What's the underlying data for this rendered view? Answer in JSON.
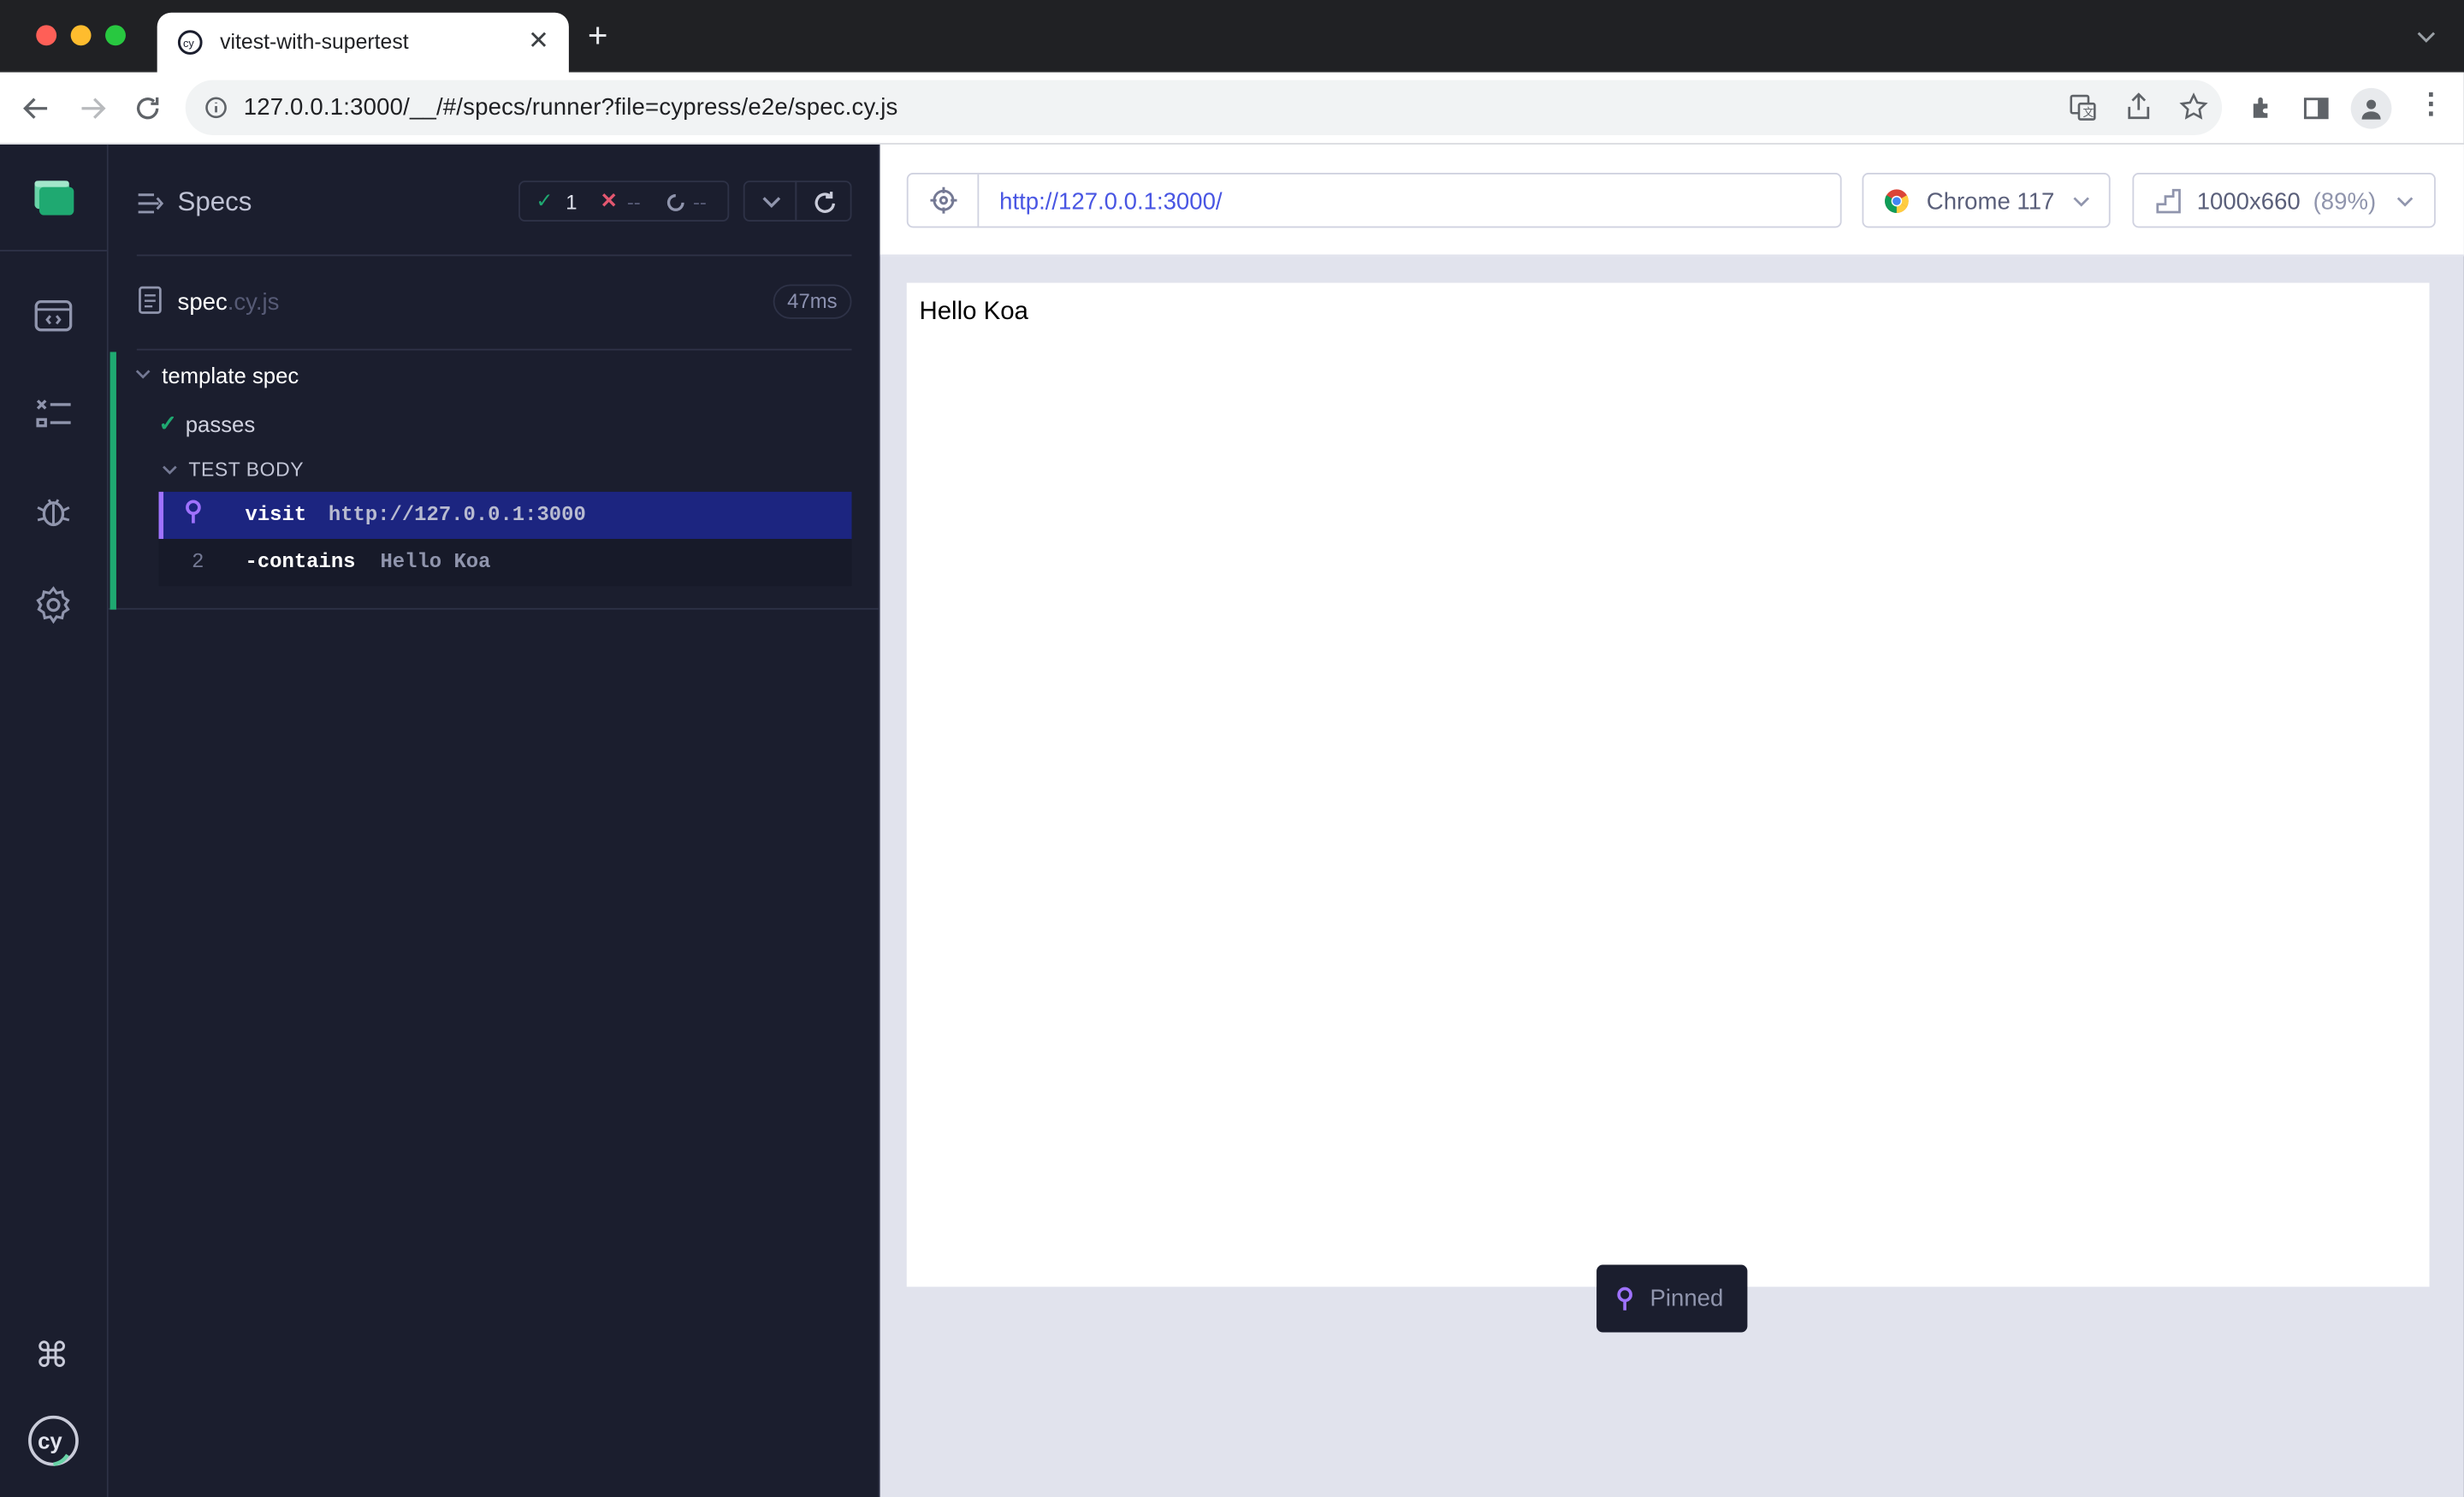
{
  "browser": {
    "tab_title": "vitest-with-supertest",
    "address": "127.0.0.1:3000/__/#/specs/runner?file=cypress/e2e/spec.cy.js"
  },
  "reporter": {
    "header": "Specs",
    "stats": {
      "passed": "1",
      "failed": "--",
      "pending": "--"
    },
    "spec": {
      "name": "spec",
      "ext": ".cy.js",
      "duration": "47ms"
    },
    "suite": "template spec",
    "test": "passes",
    "section": "TEST BODY",
    "commands": [
      {
        "number": "",
        "name": "visit",
        "arg": "http://127.0.0.1:3000"
      },
      {
        "number": "2",
        "name": "-contains",
        "arg": "Hello Koa"
      }
    ]
  },
  "aut": {
    "url": "http://127.0.0.1:3000/",
    "browser": "Chrome 117",
    "viewport": "1000x660",
    "scale": "(89%)",
    "content": "Hello Koa",
    "pinned": "Pinned"
  },
  "colors": {
    "accent_green": "#1fa971",
    "pin_purple": "#9f72ff",
    "link_blue": "#4956e3"
  }
}
